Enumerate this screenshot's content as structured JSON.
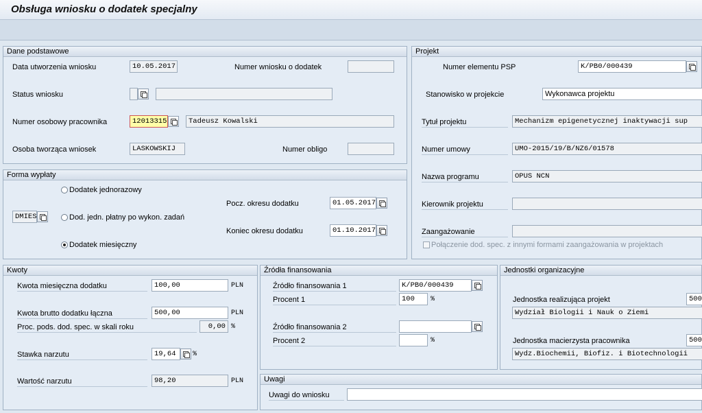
{
  "window": {
    "title": "Obsługa wniosku o dodatek specjalny"
  },
  "dane": {
    "header": "Dane podstawowe",
    "data_utw_label": "Data utworzenia wniosku",
    "data_utw": "10.05.2017",
    "numer_wniosku_label": "Numer wniosku o dodatek",
    "numer_wniosku": "",
    "status_label": "Status wniosku",
    "status": "",
    "status_text": "",
    "numer_osob_label": "Numer osobowy pracownika",
    "numer_osob": "12013315",
    "pracownik": "Tadeusz Kowalski",
    "osoba_label": "Osoba tworząca wniosek",
    "osoba": "LASKOWSKIJ",
    "obligo_label": "Numer obligo",
    "obligo": ""
  },
  "forma": {
    "header": "Forma wypłaty",
    "code": "DMIES",
    "opt1": "Dodatek jednorazowy",
    "opt2": "Dod. jedn. płatny po wykon. zadań",
    "opt3": "Dodatek miesięczny",
    "pocz_label": "Pocz. okresu dodatku",
    "pocz": "01.05.2017",
    "koniec_label": "Koniec okresu dodatku",
    "koniec": "01.10.2017"
  },
  "projekt": {
    "header": "Projekt",
    "psp_label": "Numer elementu PSP",
    "psp": "K/PB0/000439",
    "stanowisko_label": "Stanowisko w projekcie",
    "stanowisko": "Wykonawca projektu",
    "tytul_label": "Tytuł projektu",
    "tytul": "Mechanizm epigenetycznej inaktywacji sup",
    "umowa_label": "Numer umowy",
    "umowa": "UMO-2015/19/B/NZ6/01578",
    "program_label": "Nazwa programu",
    "program": "OPUS NCN",
    "kierownik_label": "Kierownik projektu",
    "kierownik": "",
    "zaang_label": "Zaangażowanie",
    "zaang": "",
    "polaczenie_label": "Połączenie dod. spec. z innymi formami zaangażowania w projektach"
  },
  "kwoty": {
    "header": "Kwoty",
    "miesieczna_label": "Kwota miesięczna dodatku",
    "miesieczna": "100,00",
    "miesieczna_unit": "PLN",
    "brutto_label": "Kwota brutto dodatku łączna",
    "brutto": "500,00",
    "brutto_unit": "PLN",
    "proc_label": "Proc. pods. dod. spec. w skali roku",
    "proc": "0,00",
    "proc_unit": "%",
    "stawka_label": "Stawka narzutu",
    "stawka": "19,64",
    "stawka_unit": "%",
    "wartosc_label": "Wartość narzutu",
    "wartosc": "98,20",
    "wartosc_unit": "PLN"
  },
  "zrodla": {
    "header": "Źródła finansowania",
    "z1_label": "Źródło finansowania 1",
    "z1": "K/PB0/000439",
    "p1_label": "Procent 1",
    "p1": "100",
    "p1_unit": "%",
    "z2_label": "Źródło finansowania 2",
    "z2": "",
    "p2_label": "Procent 2",
    "p2": "",
    "p2_unit": "%"
  },
  "jednostki": {
    "header": "Jednostki organizacyjne",
    "realiz_label": "Jednostka realizująca projekt",
    "realiz_code": "500",
    "realiz_name": "Wydział Biologii i Nauk o Ziemi",
    "macierz_label": "Jednostka macierzysta pracownika",
    "macierz_code": "500",
    "macierz_name": "Wydz.Biochemii, Biofiz. i Biotechnologii"
  },
  "uwagi": {
    "header": "Uwagi",
    "label": "Uwagi do wniosku",
    "value": ""
  }
}
